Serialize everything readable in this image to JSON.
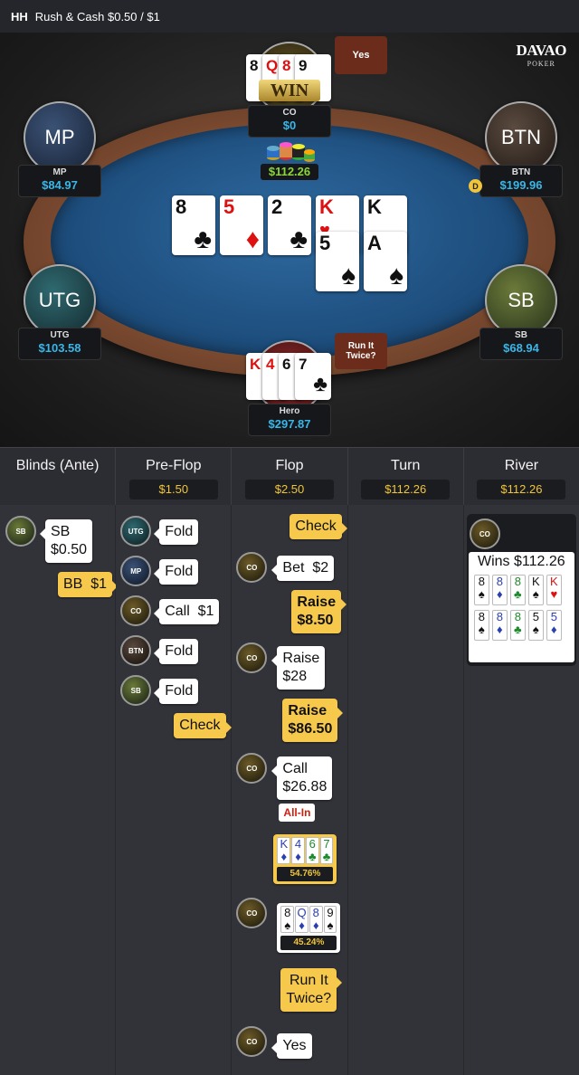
{
  "header": {
    "hh": "HH",
    "title": "Rush & Cash $0.50 / $1"
  },
  "logo": {
    "line1": "DAVAO",
    "line2": "POKER"
  },
  "table": {
    "pot": "$112.26",
    "seats": [
      {
        "id": "co",
        "circle": "",
        "name": "CO",
        "stack": "$0"
      },
      {
        "id": "mp",
        "circle": "MP",
        "name": "MP",
        "stack": "$84.97"
      },
      {
        "id": "btn",
        "circle": "BTN",
        "name": "BTN",
        "stack": "$199.96"
      },
      {
        "id": "utg",
        "circle": "UTG",
        "name": "UTG",
        "stack": "$103.58"
      },
      {
        "id": "sb",
        "circle": "SB",
        "name": "SB",
        "stack": "$68.94"
      },
      {
        "id": "hero",
        "circle": "",
        "name": "Hero",
        "stack": "$297.87"
      }
    ],
    "dealer": "D",
    "co_bubble": "Yes",
    "hero_bubble": "Run It Twice?",
    "win_text": "WIN",
    "co_cards": [
      "8",
      "Q",
      "8",
      "9"
    ],
    "hero_cards": [
      "K",
      "4",
      "6",
      "7"
    ],
    "board1": [
      "8",
      "5",
      "2",
      "K",
      "K"
    ],
    "board2": [
      "5",
      "A"
    ]
  },
  "streets": [
    {
      "name": "Blinds (Ante)",
      "pot": ""
    },
    {
      "name": "Pre-Flop",
      "pot": "$1.50"
    },
    {
      "name": "Flop",
      "pot": "$2.50"
    },
    {
      "name": "Turn",
      "pot": "$112.26"
    },
    {
      "name": "River",
      "pot": "$112.26"
    }
  ],
  "actions": {
    "sb_blind": "SB\n$0.50",
    "bb_blind": "BB  $1",
    "utg_fold": "Fold",
    "mp_fold": "Fold",
    "co_call": "Call  $1",
    "btn_fold": "Fold",
    "sb_fold": "Fold",
    "hero_check_pf": "Check",
    "hero_check_flop": "Check",
    "co_bet": "Bet  $2",
    "hero_raise1": "Raise\n$8.50",
    "co_raise": "Raise\n$28",
    "hero_raise2": "Raise\n$86.50",
    "co_call2": "Call\n$26.88",
    "allin": "All-In",
    "hero_equity": "54.76%",
    "co_equity": "45.24%",
    "hero_rit": "Run It\nTwice?",
    "co_yes": "Yes"
  },
  "avatars": {
    "sb": "SB",
    "utg": "UTG",
    "mp": "MP",
    "co": "CO",
    "btn": "BTN"
  },
  "river": {
    "wins": "Wins $112.26"
  }
}
